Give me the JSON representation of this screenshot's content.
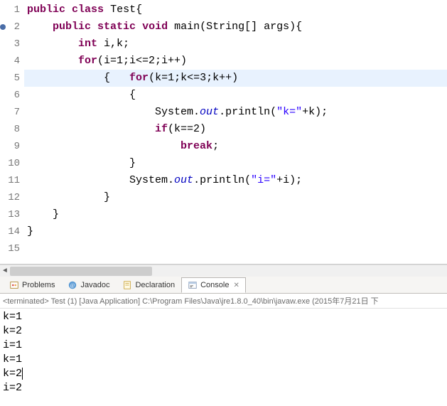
{
  "editor": {
    "lines": [
      {
        "n": "1",
        "html": "<span class='kw'>public</span> <span class='kw'>class</span> <span class='plain'>Test{</span>"
      },
      {
        "n": "2",
        "bp": true,
        "html": "    <span class='kw'>public</span> <span class='kw'>static</span> <span class='kw'>void</span> <span class='plain'>main(String[] args){</span>"
      },
      {
        "n": "3",
        "html": "        <span class='kw'>int</span> <span class='plain'>i,k;</span>"
      },
      {
        "n": "4",
        "html": "        <span class='kw'>for</span><span class='plain'>(i=1;i&lt;=2;i++)</span>"
      },
      {
        "n": "5",
        "hl": true,
        "html": "            <span class='plain'>{   </span><span class='kw'>for</span><span class='plain'>(k=1;k&lt;=3;k++)</span>"
      },
      {
        "n": "6",
        "html": "                <span class='plain'>{</span>"
      },
      {
        "n": "7",
        "html": "                    <span class='plain'>System.</span><span class='it'>out</span><span class='plain'>.println(</span><span class='str'>\"k=\"</span><span class='plain'>+k);</span>"
      },
      {
        "n": "8",
        "html": "                    <span class='kw'>if</span><span class='plain'>(k==2)</span>"
      },
      {
        "n": "9",
        "html": "                        <span class='kw'>break</span><span class='plain'>;</span>"
      },
      {
        "n": "10",
        "html": "                <span class='plain'>}</span>"
      },
      {
        "n": "11",
        "html": "                <span class='plain'>System.</span><span class='it'>out</span><span class='plain'>.println(</span><span class='str'>\"i=\"</span><span class='plain'>+i);</span>"
      },
      {
        "n": "12",
        "html": "            <span class='plain'>}</span>"
      },
      {
        "n": "13",
        "html": "    <span class='plain'>}</span>"
      },
      {
        "n": "14",
        "html": "<span class='plain'>}</span>"
      },
      {
        "n": "15",
        "html": ""
      }
    ]
  },
  "tabs": {
    "items": [
      {
        "id": "problems",
        "label": "Problems"
      },
      {
        "id": "javadoc",
        "label": "Javadoc"
      },
      {
        "id": "declaration",
        "label": "Declaration"
      },
      {
        "id": "console",
        "label": "Console",
        "active": true
      }
    ]
  },
  "console": {
    "info": "<terminated> Test (1) [Java Application] C:\\Program Files\\Java\\jre1.8.0_40\\bin\\javaw.exe (2015年7月21日 下",
    "lines": [
      "k=1",
      "k=2",
      "i=1",
      "k=1",
      "k=2",
      "i=2"
    ]
  }
}
